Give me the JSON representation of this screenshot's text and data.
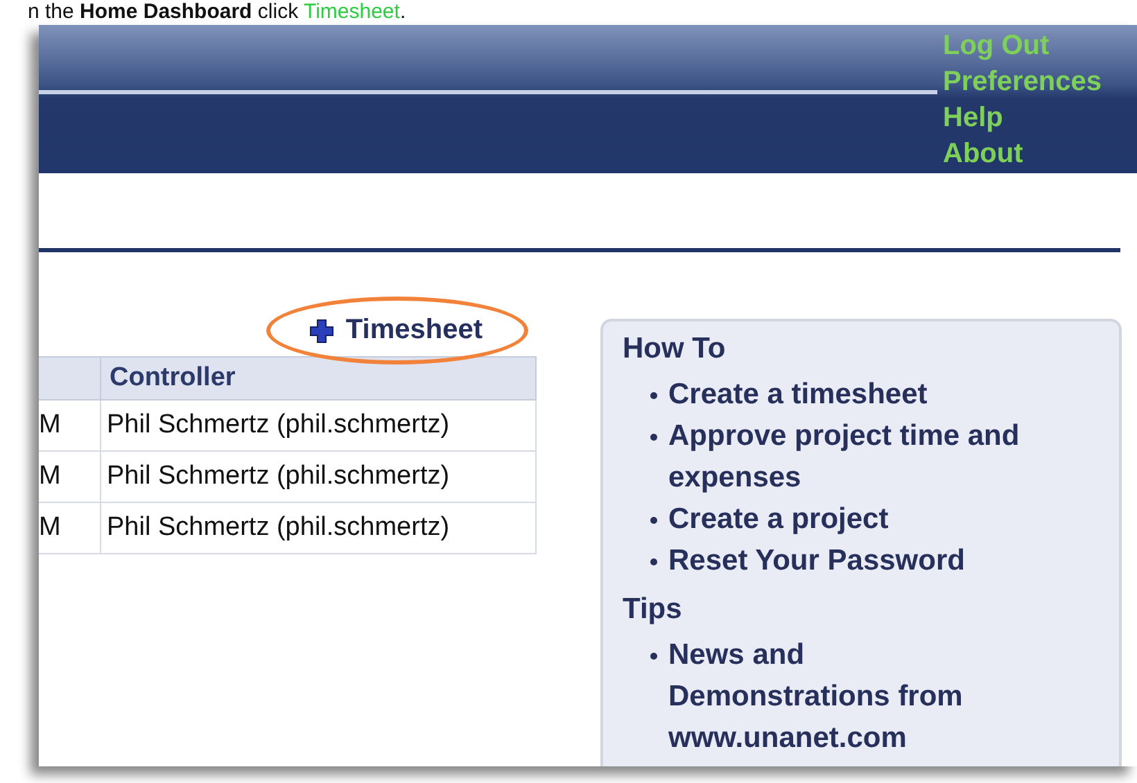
{
  "instruction": {
    "before": "n the ",
    "bold": "Home Dashboard",
    "middle": " click ",
    "link": "Timesheet",
    "after": "."
  },
  "header": {
    "links": [
      "Log Out",
      "Preferences",
      "Help",
      "About"
    ]
  },
  "timesheet_button": {
    "label": "Timesheet",
    "highlighted": true
  },
  "table": {
    "columns": [
      "",
      "Controller"
    ],
    "rows": [
      [
        "M",
        "Phil Schmertz (phil.schmertz)"
      ],
      [
        "M",
        "Phil Schmertz (phil.schmertz)"
      ],
      [
        "M",
        "Phil Schmertz (phil.schmertz)"
      ]
    ]
  },
  "side_panel": {
    "sections": [
      {
        "title": "How To",
        "items": [
          "Create a timesheet",
          "Approve project time and expenses",
          "Create a project",
          "Reset Your Password"
        ]
      },
      {
        "title": "Tips",
        "items": [
          "News and Demonstrations from www.unanet.com"
        ]
      }
    ]
  }
}
